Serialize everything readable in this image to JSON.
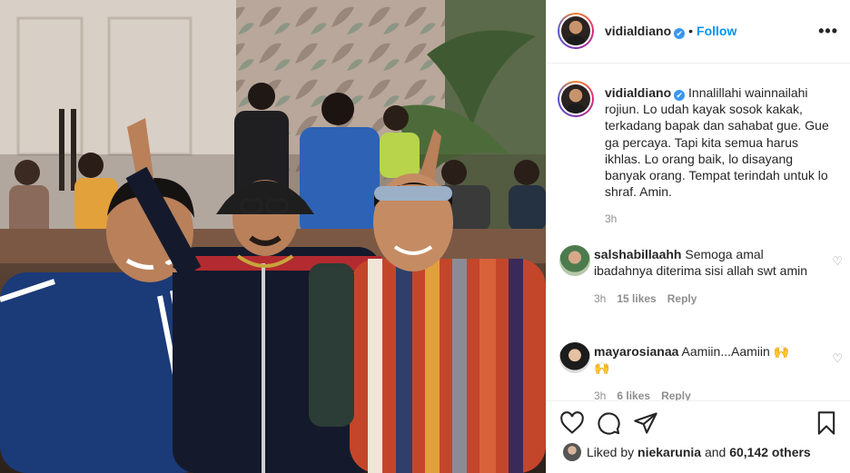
{
  "post": {
    "username": "vidialdiano",
    "verified_mark": "✔",
    "separator": "•",
    "follow_label": "Follow",
    "more_icon": "•••"
  },
  "caption": {
    "username": "vidialdiano",
    "text": "Innalillahi wainnailahi rojiun. Lo udah kayak sosok kakak, terkadang bapak dan sahabat gue. Gue ga percaya. Tapi kita semua harus ikhlas. Lo orang baik, lo disayang banyak orang. Tempat terindah untuk lo shraf. Amin.",
    "time": "3h"
  },
  "comments": [
    {
      "username": "salshabillaahh",
      "text": "Semoga amal ibadahnya diterima sisi allah swt amin",
      "time": "3h",
      "likes": "15 likes",
      "reply_label": "Reply"
    },
    {
      "username": "mayarosianaa",
      "text": "Aamiin...Aamiin 🙌 🙌",
      "time": "3h",
      "likes": "6 likes",
      "reply_label": "Reply"
    }
  ],
  "likes": {
    "prefix": "Liked by",
    "user": "niekarunia",
    "middle": "and",
    "count": "60,142 others"
  },
  "icons": [
    "heart-icon",
    "comment-icon",
    "share-icon",
    "bookmark-icon"
  ],
  "colors": {
    "accent": "#0095f6",
    "verified": "#3897f0",
    "muted": "#8e8e8e"
  }
}
